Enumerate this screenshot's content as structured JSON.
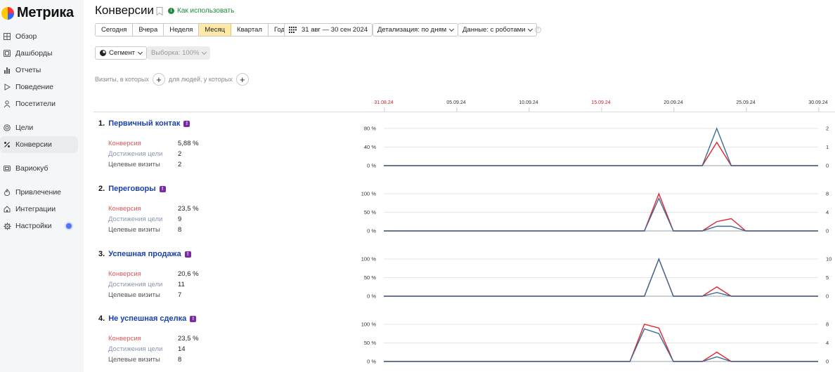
{
  "app": {
    "logo_text": "Метрика",
    "brand_colors": {
      "yellow": "#ffcc00",
      "red": "#ff3333",
      "blue": "#3366ff"
    }
  },
  "sidebar": {
    "items": [
      {
        "id": "overview",
        "label": "Обзор",
        "icon": "grid-icon"
      },
      {
        "id": "dashboards",
        "label": "Дашборды",
        "icon": "dashboard-icon"
      },
      {
        "id": "reports",
        "label": "Отчеты",
        "icon": "bar-chart-icon"
      },
      {
        "id": "behavior",
        "label": "Поведение",
        "icon": "play-icon"
      },
      {
        "id": "visitors",
        "label": "Посетители",
        "icon": "person-icon"
      },
      {
        "id": "goals",
        "label": "Цели",
        "icon": "target-icon"
      },
      {
        "id": "conversions",
        "label": "Конверсии",
        "icon": "percent-icon",
        "active": true
      },
      {
        "id": "variocube",
        "label": "Вариокуб",
        "icon": "cube-icon"
      },
      {
        "id": "acquisition",
        "label": "Привлечение",
        "icon": "flame-icon"
      },
      {
        "id": "integrations",
        "label": "Интеграции",
        "icon": "plug-icon"
      },
      {
        "id": "settings",
        "label": "Настройки",
        "icon": "gear-icon",
        "has_notification": true
      }
    ]
  },
  "header": {
    "title": "Конверсии",
    "howto": "Как использовать"
  },
  "toolbar": {
    "periods": [
      "Сегодня",
      "Вчера",
      "Неделя",
      "Месяц",
      "Квартал",
      "Год"
    ],
    "selected_period": "Месяц",
    "date_range": "31 авг — 30 сен 2024",
    "detail": "Детализация: по дням",
    "data": "Данные: с роботами",
    "segment": "Сегмент",
    "sample": "Выборка: 100%"
  },
  "filters": {
    "visits_label": "Визиты, в которых",
    "people_label": "для людей, у которых"
  },
  "timeline": {
    "dates": [
      {
        "label": "31.08.24",
        "day": 0,
        "weekend": true
      },
      {
        "label": "05.09.24",
        "day": 5,
        "weekend": false
      },
      {
        "label": "10.09.24",
        "day": 10,
        "weekend": false
      },
      {
        "label": "15.09.24",
        "day": 15,
        "weekend": true
      },
      {
        "label": "20.09.24",
        "day": 20,
        "weekend": false
      },
      {
        "label": "25.09.24",
        "day": 25,
        "weekend": false
      },
      {
        "label": "30.09.24",
        "day": 30,
        "weekend": false
      }
    ]
  },
  "goals": [
    {
      "num": "1.",
      "name": "Первичный контак",
      "conv_label": "Конверсия",
      "conv": "5,88 %",
      "ach_label": "Достижения цели",
      "ach": "2",
      "vis_label": "Целевые визиты",
      "vis": "2"
    },
    {
      "num": "2.",
      "name": "Переговоры",
      "conv_label": "Конверсия",
      "conv": "23,5 %",
      "ach_label": "Достижения цели",
      "ach": "9",
      "vis_label": "Целевые визиты",
      "vis": "8"
    },
    {
      "num": "3.",
      "name": "Успешная продажа",
      "conv_label": "Конверсия",
      "conv": "20,6 %",
      "ach_label": "Достижения цели",
      "ach": "11",
      "vis_label": "Целевые визиты",
      "vis": "7"
    },
    {
      "num": "4.",
      "name": "Не успешная сделка",
      "conv_label": "Конверсия",
      "conv": "23,5 %",
      "ach_label": "Достижения цели",
      "ach": "14",
      "vis_label": "Целевые визиты",
      "vis": "8"
    }
  ],
  "chart_data": [
    {
      "type": "line",
      "x_days": [
        0,
        22,
        23,
        24,
        30
      ],
      "left_ticks": [
        "80 %",
        "40 %",
        "0 %"
      ],
      "left_max": 80,
      "right_ticks": [
        "2",
        "1",
        "0"
      ],
      "right_max": 2,
      "series": [
        {
          "axis": "left",
          "color": "#e0262e",
          "values": [
            0,
            0,
            50,
            0,
            0
          ]
        },
        {
          "axis": "right",
          "color": "#3b6b94",
          "values": [
            0,
            0,
            2,
            0,
            0
          ]
        }
      ]
    },
    {
      "type": "line",
      "x_days": [
        0,
        18,
        19,
        20,
        22,
        23,
        24,
        25,
        30
      ],
      "left_ticks": [
        "100 %",
        "50 %",
        "0 %"
      ],
      "left_max": 100,
      "right_ticks": [
        "8",
        "4",
        "0"
      ],
      "right_max": 8,
      "series": [
        {
          "axis": "left",
          "color": "#e0262e",
          "values": [
            0,
            0,
            100,
            0,
            0,
            25,
            33,
            0,
            0
          ]
        },
        {
          "axis": "right",
          "color": "#3b6b94",
          "values": [
            0,
            0,
            7,
            0,
            0,
            1,
            1,
            0,
            0
          ]
        }
      ]
    },
    {
      "type": "line",
      "x_days": [
        0,
        18,
        19,
        20,
        22,
        23,
        24,
        30
      ],
      "left_ticks": [
        "100 %",
        "50 %",
        "0 %"
      ],
      "left_max": 100,
      "right_ticks": [
        "10",
        "5",
        "0"
      ],
      "right_max": 10,
      "series": [
        {
          "axis": "left",
          "color": "#e0262e",
          "values": [
            0,
            0,
            100,
            0,
            0,
            25,
            0,
            0
          ]
        },
        {
          "axis": "right",
          "color": "#3b6b94",
          "values": [
            0,
            0,
            10,
            0,
            0,
            1,
            0,
            0
          ]
        }
      ]
    },
    {
      "type": "line",
      "x_days": [
        0,
        17,
        18,
        19,
        20,
        22,
        23,
        24,
        30
      ],
      "left_ticks": [
        "100 %",
        "50 %",
        "0 %"
      ],
      "left_max": 100,
      "right_ticks": [
        "8",
        "4",
        "0"
      ],
      "right_max": 8,
      "series": [
        {
          "axis": "left",
          "color": "#e0262e",
          "values": [
            0,
            0,
            100,
            90,
            0,
            0,
            25,
            0,
            0
          ]
        },
        {
          "axis": "right",
          "color": "#3b6b94",
          "values": [
            0,
            0,
            7,
            6,
            0,
            0,
            1,
            0,
            0
          ]
        }
      ]
    }
  ]
}
